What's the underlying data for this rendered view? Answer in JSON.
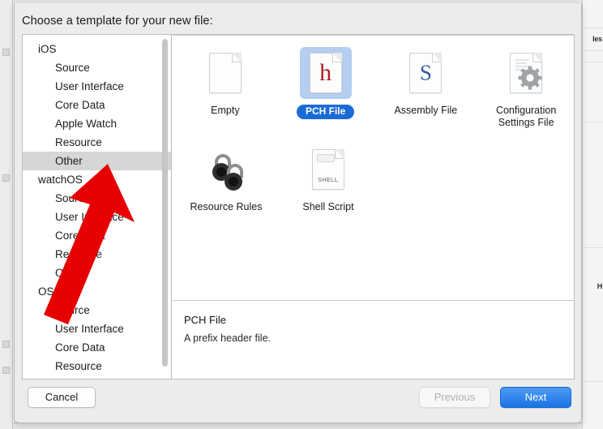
{
  "dialog": {
    "title": "Choose a template for your new file:"
  },
  "sidebar": {
    "groups": [
      {
        "name": "iOS",
        "items": [
          "Source",
          "User Interface",
          "Core Data",
          "Apple Watch",
          "Resource",
          "Other"
        ],
        "selected_item": "Other"
      },
      {
        "name": "watchOS",
        "items": [
          "Source",
          "User Interface",
          "Core Data",
          "Resource",
          "Other"
        ],
        "selected_item": null
      },
      {
        "name": "OS X",
        "items": [
          "Source",
          "User Interface",
          "Core Data",
          "Resource"
        ],
        "selected_item": null
      }
    ],
    "rows": [
      {
        "label": "iOS",
        "level": "group",
        "selected": false
      },
      {
        "label": "Source",
        "level": "child",
        "selected": false
      },
      {
        "label": "User Interface",
        "level": "child",
        "selected": false
      },
      {
        "label": "Core Data",
        "level": "child",
        "selected": false
      },
      {
        "label": "Apple Watch",
        "level": "child",
        "selected": false
      },
      {
        "label": "Resource",
        "level": "child",
        "selected": false
      },
      {
        "label": "Other",
        "level": "child",
        "selected": true
      },
      {
        "label": "watchOS",
        "level": "group",
        "selected": false
      },
      {
        "label": "Source",
        "level": "child",
        "selected": false
      },
      {
        "label": "User Interface",
        "level": "child",
        "selected": false
      },
      {
        "label": "Core Data",
        "level": "child",
        "selected": false
      },
      {
        "label": "Resource",
        "level": "child",
        "selected": false
      },
      {
        "label": "Other",
        "level": "child",
        "selected": false
      },
      {
        "label": "OS X",
        "level": "group",
        "selected": false
      },
      {
        "label": "Source",
        "level": "child",
        "selected": false
      },
      {
        "label": "User Interface",
        "level": "child",
        "selected": false
      },
      {
        "label": "Core Data",
        "level": "child",
        "selected": false
      },
      {
        "label": "Resource",
        "level": "child",
        "selected": false
      }
    ],
    "scrollbar": {
      "name": "sidebar-scrollbar"
    }
  },
  "templates": {
    "row1": [
      {
        "label": "Empty",
        "icon": "blank-document-icon",
        "selected": false
      },
      {
        "label": "PCH File",
        "icon": "h-header-document-icon",
        "selected": true
      },
      {
        "label": "Assembly File",
        "icon": "s-assembly-document-icon",
        "selected": false
      },
      {
        "label": "Configuration Settings File",
        "icon": "gear-document-icon",
        "selected": false
      }
    ],
    "row2": [
      {
        "label": "Resource Rules",
        "icon": "padlocks-icon",
        "selected": false
      },
      {
        "label": "Shell Script",
        "icon": "shell-document-icon",
        "selected": false
      }
    ],
    "glyphs": {
      "pch": "h",
      "assembly": "S",
      "shell_tag": "SHELL"
    }
  },
  "description": {
    "title": "PCH File",
    "body": "A prefix header file."
  },
  "footer": {
    "cancel_label": "Cancel",
    "previous_label": "Previous",
    "next_label": "Next"
  },
  "background": {
    "right_text": "les",
    "right_text2": "H"
  },
  "colors": {
    "accent_blue": "#1b6bd6",
    "selection_fill": "#b5cdf0",
    "sidebar_selection": "#d6d6d6",
    "annotation_red": "#e60000",
    "pch_glyph_red": "#b01d28",
    "assembly_glyph_blue": "#3a5b9e"
  },
  "annotation": {
    "arrow": "red-pointer-arrow"
  }
}
